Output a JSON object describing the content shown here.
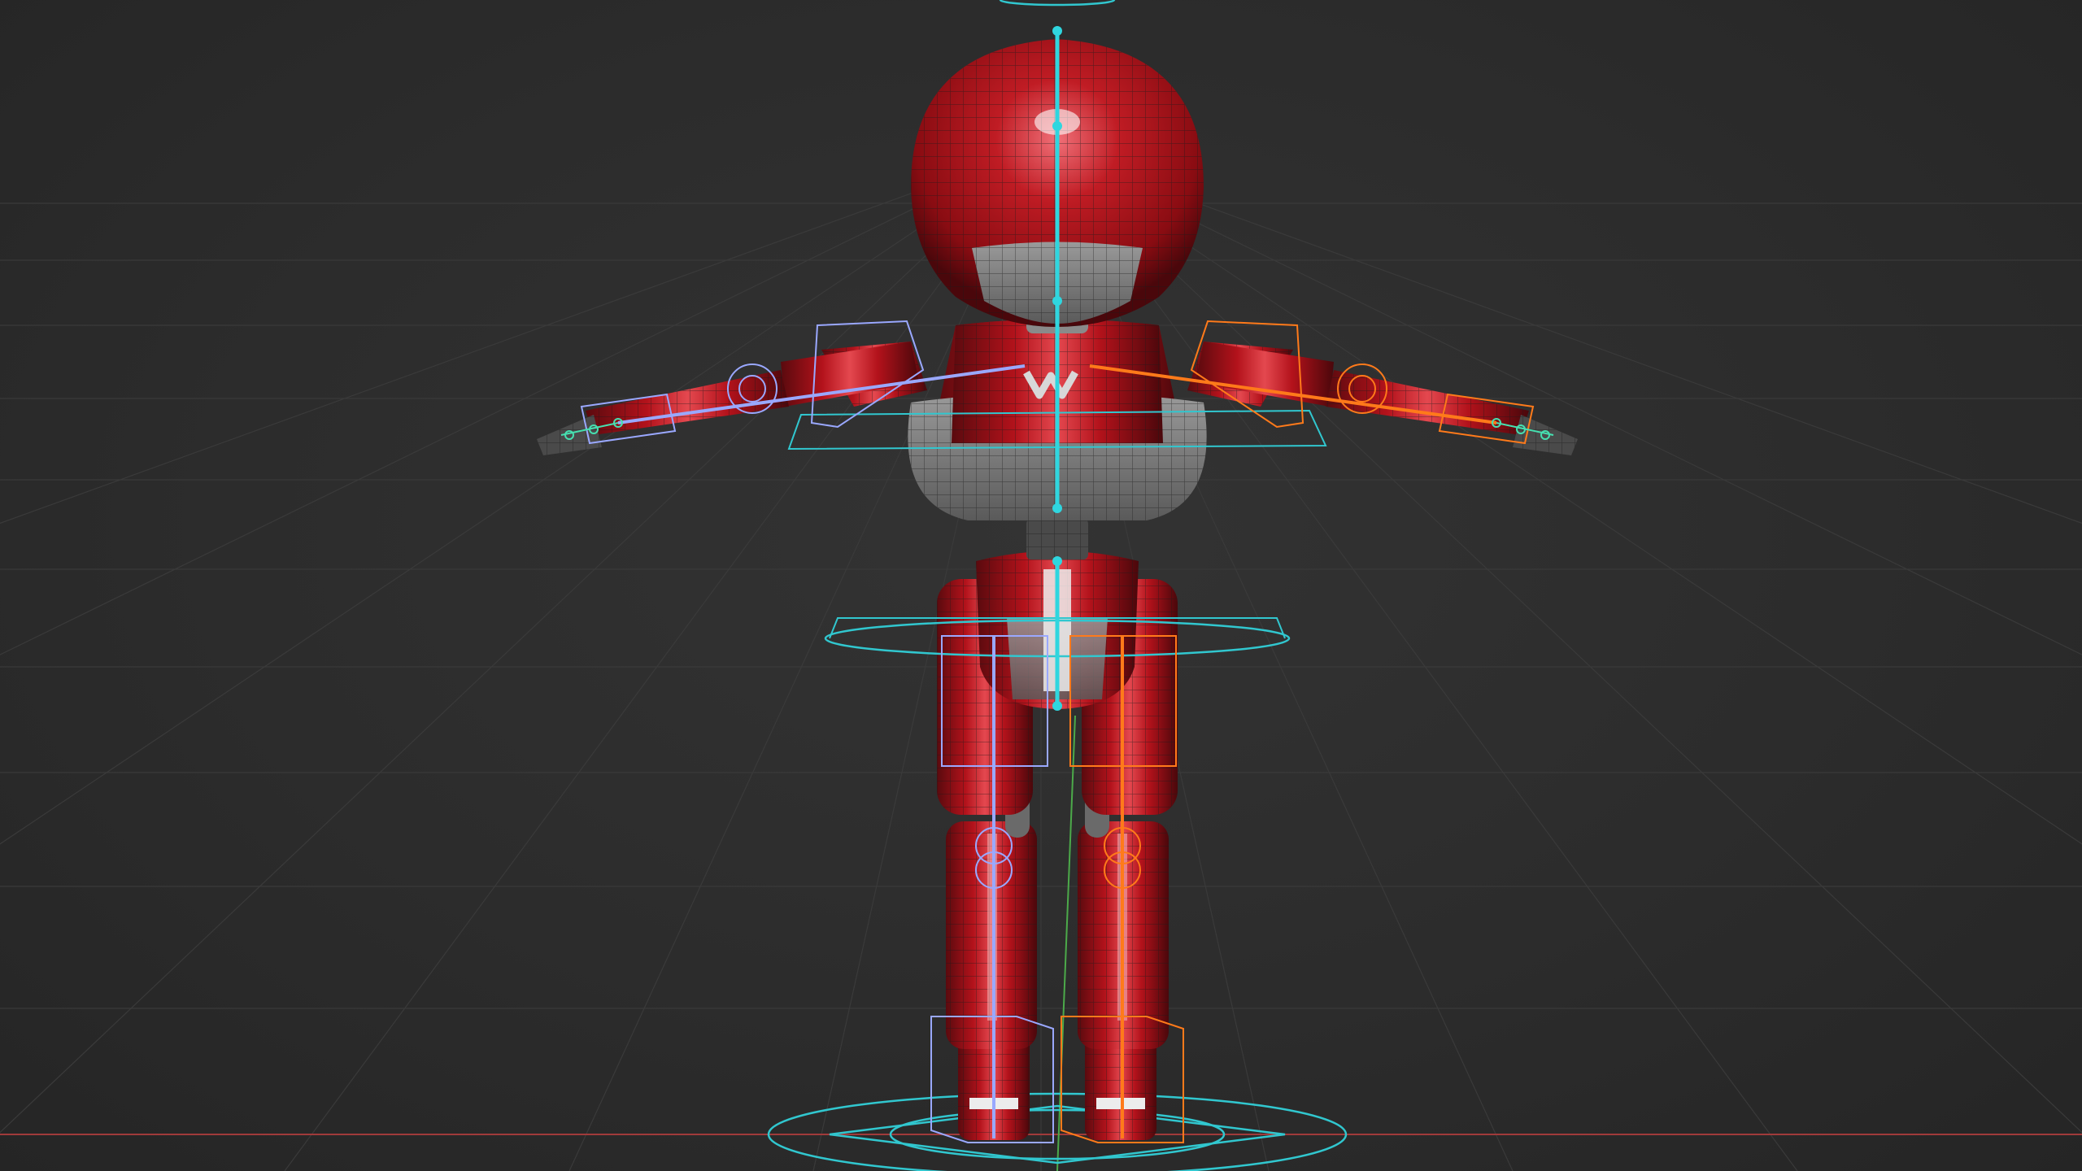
{
  "viewport": {
    "title": "",
    "background_color": "#2b2b2b",
    "grid_line_color": "#3a3a3a",
    "horizon_axis_color": "#a03a3a",
    "vertical_axis_color": "#4caa4a"
  },
  "model": {
    "description": "",
    "body_color": "#b3121b",
    "body_highlight_color": "#e4484f",
    "panel_color": "#8c8c8c",
    "wire_color": "#1c1c1c"
  },
  "rig": {
    "center_bone_color": "#2fd6df",
    "left_side_color": "#9aa8ff",
    "right_side_color": "#ff7a1a",
    "control_circle_color": "#31c7cf"
  }
}
